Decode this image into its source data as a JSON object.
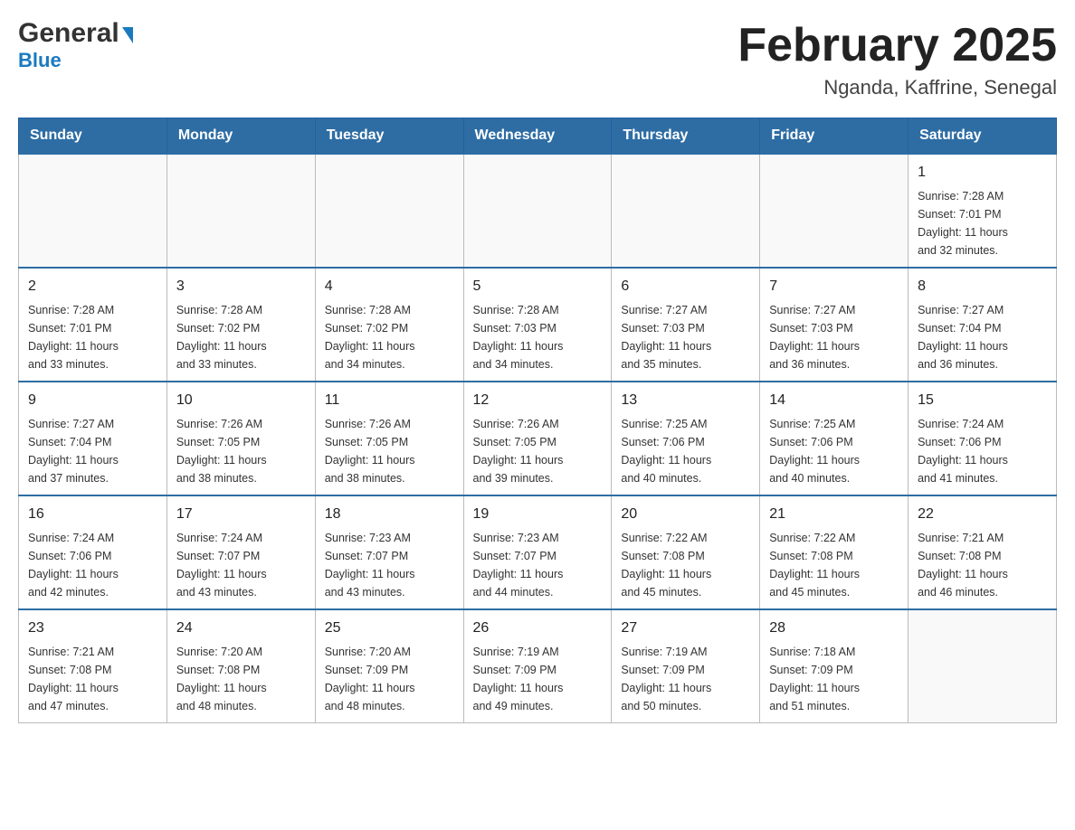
{
  "header": {
    "logo_general": "General",
    "logo_blue": "Blue",
    "month_title": "February 2025",
    "location": "Nganda, Kaffrine, Senegal"
  },
  "days_of_week": [
    "Sunday",
    "Monday",
    "Tuesday",
    "Wednesday",
    "Thursday",
    "Friday",
    "Saturday"
  ],
  "weeks": [
    [
      {
        "day": "",
        "info": ""
      },
      {
        "day": "",
        "info": ""
      },
      {
        "day": "",
        "info": ""
      },
      {
        "day": "",
        "info": ""
      },
      {
        "day": "",
        "info": ""
      },
      {
        "day": "",
        "info": ""
      },
      {
        "day": "1",
        "info": "Sunrise: 7:28 AM\nSunset: 7:01 PM\nDaylight: 11 hours\nand 32 minutes."
      }
    ],
    [
      {
        "day": "2",
        "info": "Sunrise: 7:28 AM\nSunset: 7:01 PM\nDaylight: 11 hours\nand 33 minutes."
      },
      {
        "day": "3",
        "info": "Sunrise: 7:28 AM\nSunset: 7:02 PM\nDaylight: 11 hours\nand 33 minutes."
      },
      {
        "day": "4",
        "info": "Sunrise: 7:28 AM\nSunset: 7:02 PM\nDaylight: 11 hours\nand 34 minutes."
      },
      {
        "day": "5",
        "info": "Sunrise: 7:28 AM\nSunset: 7:03 PM\nDaylight: 11 hours\nand 34 minutes."
      },
      {
        "day": "6",
        "info": "Sunrise: 7:27 AM\nSunset: 7:03 PM\nDaylight: 11 hours\nand 35 minutes."
      },
      {
        "day": "7",
        "info": "Sunrise: 7:27 AM\nSunset: 7:03 PM\nDaylight: 11 hours\nand 36 minutes."
      },
      {
        "day": "8",
        "info": "Sunrise: 7:27 AM\nSunset: 7:04 PM\nDaylight: 11 hours\nand 36 minutes."
      }
    ],
    [
      {
        "day": "9",
        "info": "Sunrise: 7:27 AM\nSunset: 7:04 PM\nDaylight: 11 hours\nand 37 minutes."
      },
      {
        "day": "10",
        "info": "Sunrise: 7:26 AM\nSunset: 7:05 PM\nDaylight: 11 hours\nand 38 minutes."
      },
      {
        "day": "11",
        "info": "Sunrise: 7:26 AM\nSunset: 7:05 PM\nDaylight: 11 hours\nand 38 minutes."
      },
      {
        "day": "12",
        "info": "Sunrise: 7:26 AM\nSunset: 7:05 PM\nDaylight: 11 hours\nand 39 minutes."
      },
      {
        "day": "13",
        "info": "Sunrise: 7:25 AM\nSunset: 7:06 PM\nDaylight: 11 hours\nand 40 minutes."
      },
      {
        "day": "14",
        "info": "Sunrise: 7:25 AM\nSunset: 7:06 PM\nDaylight: 11 hours\nand 40 minutes."
      },
      {
        "day": "15",
        "info": "Sunrise: 7:24 AM\nSunset: 7:06 PM\nDaylight: 11 hours\nand 41 minutes."
      }
    ],
    [
      {
        "day": "16",
        "info": "Sunrise: 7:24 AM\nSunset: 7:06 PM\nDaylight: 11 hours\nand 42 minutes."
      },
      {
        "day": "17",
        "info": "Sunrise: 7:24 AM\nSunset: 7:07 PM\nDaylight: 11 hours\nand 43 minutes."
      },
      {
        "day": "18",
        "info": "Sunrise: 7:23 AM\nSunset: 7:07 PM\nDaylight: 11 hours\nand 43 minutes."
      },
      {
        "day": "19",
        "info": "Sunrise: 7:23 AM\nSunset: 7:07 PM\nDaylight: 11 hours\nand 44 minutes."
      },
      {
        "day": "20",
        "info": "Sunrise: 7:22 AM\nSunset: 7:08 PM\nDaylight: 11 hours\nand 45 minutes."
      },
      {
        "day": "21",
        "info": "Sunrise: 7:22 AM\nSunset: 7:08 PM\nDaylight: 11 hours\nand 45 minutes."
      },
      {
        "day": "22",
        "info": "Sunrise: 7:21 AM\nSunset: 7:08 PM\nDaylight: 11 hours\nand 46 minutes."
      }
    ],
    [
      {
        "day": "23",
        "info": "Sunrise: 7:21 AM\nSunset: 7:08 PM\nDaylight: 11 hours\nand 47 minutes."
      },
      {
        "day": "24",
        "info": "Sunrise: 7:20 AM\nSunset: 7:08 PM\nDaylight: 11 hours\nand 48 minutes."
      },
      {
        "day": "25",
        "info": "Sunrise: 7:20 AM\nSunset: 7:09 PM\nDaylight: 11 hours\nand 48 minutes."
      },
      {
        "day": "26",
        "info": "Sunrise: 7:19 AM\nSunset: 7:09 PM\nDaylight: 11 hours\nand 49 minutes."
      },
      {
        "day": "27",
        "info": "Sunrise: 7:19 AM\nSunset: 7:09 PM\nDaylight: 11 hours\nand 50 minutes."
      },
      {
        "day": "28",
        "info": "Sunrise: 7:18 AM\nSunset: 7:09 PM\nDaylight: 11 hours\nand 51 minutes."
      },
      {
        "day": "",
        "info": ""
      }
    ]
  ],
  "colors": {
    "header_bg": "#2e6da4",
    "header_text": "#ffffff",
    "border": "#999999",
    "blue_accent": "#1a7abf"
  }
}
